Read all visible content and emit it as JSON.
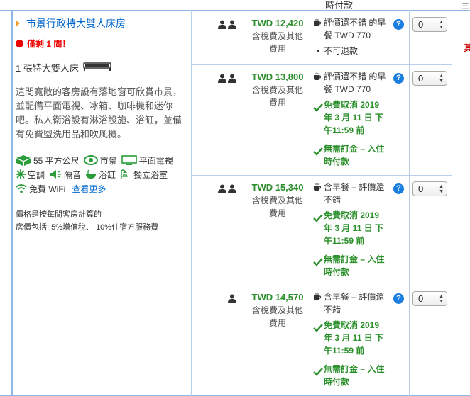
{
  "top_fragment": "時付款",
  "right_edge_char": "三",
  "right_edge_red": "其",
  "room": {
    "title": "市景行政特大雙人床房",
    "scarcity": "僅剩 1 間！",
    "bed": "1 張特大雙人床",
    "description": "這間寬敞的客房設有落地窗可欣賞市景，並配備平面電視、冰箱、咖啡機和迷你吧。私人衛浴設有淋浴設施、浴缸，並備有免費盥洗用品和吹風機。",
    "amenities": {
      "size": "55 平方公尺",
      "view": "市景",
      "tv": "平面電視",
      "ac": "空調",
      "soundproof": "隔音",
      "bathtub": "浴缸",
      "private_bath": "獨立浴室",
      "wifi": "免費 WiFi",
      "more": "查看更多"
    },
    "price_note_1": "價格是按每間客房計算的",
    "price_note_2": "房價包括: 5%增值稅、 10%住宿方服務費"
  },
  "offers": [
    {
      "guests": 2,
      "price": "TWD 12,420",
      "price_sub_1": "含稅費及其他",
      "price_sub_2": "費用",
      "meal_1": "評價還不錯 的早",
      "meal_2": "餐 TWD 770",
      "free_cancel_1": "",
      "free_cancel_2": "",
      "free_cancel_3": "",
      "no_prepay_1": "",
      "no_prepay_2": "",
      "non_refundable": "不可退款",
      "qty": "0"
    },
    {
      "guests": 2,
      "price": "TWD 13,800",
      "price_sub_1": "含稅費及其他",
      "price_sub_2": "費用",
      "meal_1": "評價還不錯 的早",
      "meal_2": "餐 TWD 770",
      "free_cancel_1": "免費取消 2019",
      "free_cancel_2": "年 3 月 11 日 下",
      "free_cancel_3": "午11:59 前",
      "no_prepay_1": "無需訂金 – 入住",
      "no_prepay_2": "時付款",
      "qty": "0"
    },
    {
      "guests": 2,
      "price": "TWD 15,340",
      "price_sub_1": "含稅費及其他",
      "price_sub_2": "費用",
      "meal_1": "含早餐 – 評價還",
      "meal_2": "不錯",
      "free_cancel_1": "免費取消 2019",
      "free_cancel_2": "年 3 月 11 日 下",
      "free_cancel_3": "午11:59 前",
      "no_prepay_1": "無需訂金 – 入住",
      "no_prepay_2": "時付款",
      "qty": "0"
    },
    {
      "guests": 1,
      "price": "TWD 14,570",
      "price_sub_1": "含稅費及其他",
      "price_sub_2": "費用",
      "meal_1": "含早餐 – 評價還",
      "meal_2": "不錯",
      "free_cancel_1": "免費取消 2019",
      "free_cancel_2": "年 3 月 11 日 下",
      "free_cancel_3": "午11:59 前",
      "no_prepay_1": "無需訂金 – 入住",
      "no_prepay_2": "時付款",
      "qty": "0"
    }
  ],
  "colors": {
    "link": "#0066cc",
    "price_green": "#2a8f2a",
    "scarcity_red": "#e00000",
    "info_blue": "#1a7de0",
    "border_blue": "#8fb8e6"
  }
}
